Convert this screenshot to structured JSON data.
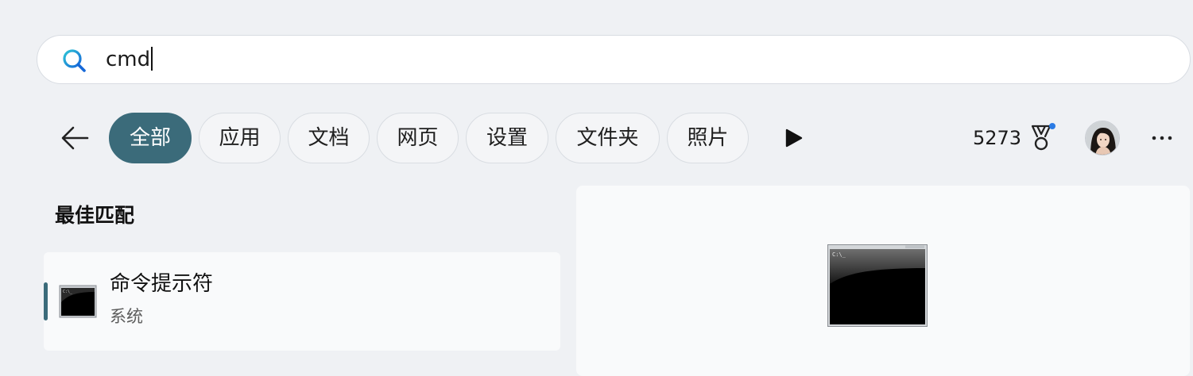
{
  "search": {
    "query": "cmd"
  },
  "filters": [
    {
      "label": "全部",
      "active": true
    },
    {
      "label": "应用",
      "active": false
    },
    {
      "label": "文档",
      "active": false
    },
    {
      "label": "网页",
      "active": false
    },
    {
      "label": "设置",
      "active": false
    },
    {
      "label": "文件夹",
      "active": false
    },
    {
      "label": "照片",
      "active": false
    }
  ],
  "header": {
    "points": "5273"
  },
  "best_match": {
    "section_title": "最佳匹配",
    "result": {
      "title": "命令提示符",
      "subtitle": "系统",
      "icon": "command-prompt-icon"
    }
  },
  "icons": {
    "search": "search-icon",
    "back": "back-arrow-icon",
    "more_filters": "play-icon",
    "rewards": "medal-icon",
    "more": "more-icon"
  },
  "colors": {
    "accent": "#3b6b7a",
    "background": "#eff1f4",
    "notification_dot": "#2b7be4"
  }
}
